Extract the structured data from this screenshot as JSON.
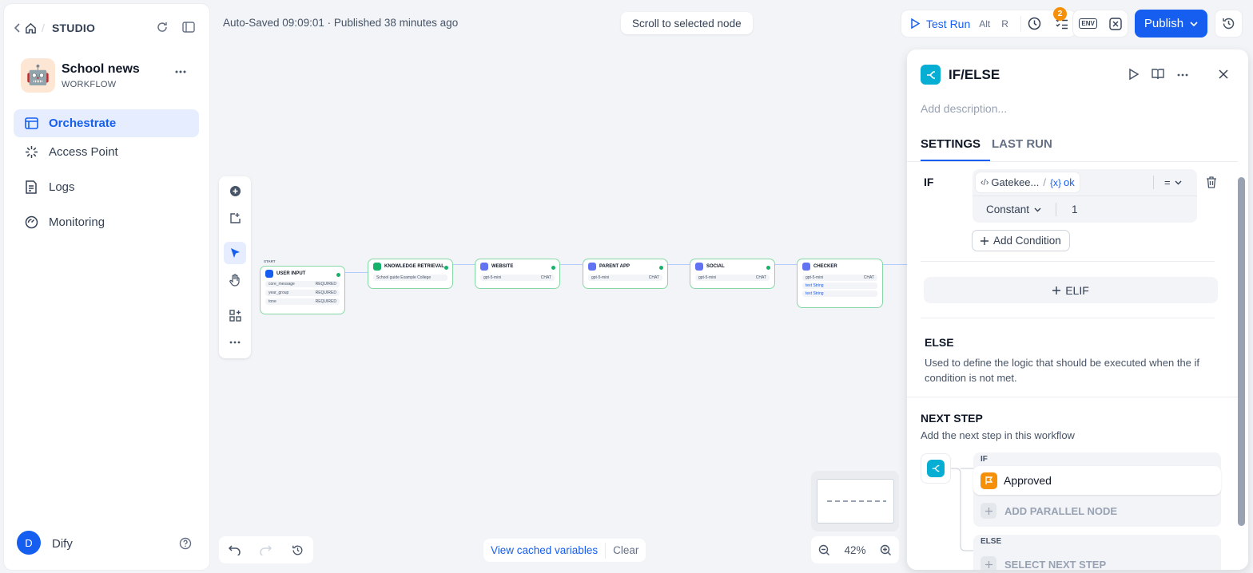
{
  "sidebar": {
    "breadcrumb": "STUDIO",
    "app": {
      "name": "School news",
      "type": "WORKFLOW"
    },
    "nav": [
      {
        "label": "Orchestrate",
        "active": true,
        "icon": "orchestrate-icon"
      },
      {
        "label": "Access Point",
        "active": false,
        "icon": "access-point-icon"
      },
      {
        "label": "Logs",
        "active": false,
        "icon": "logs-icon"
      },
      {
        "label": "Monitoring",
        "active": false,
        "icon": "monitoring-icon"
      }
    ],
    "user": {
      "initial": "D",
      "name": "Dify"
    }
  },
  "header": {
    "status": "Auto-Saved 09:09:01 · Published 38 minutes ago",
    "scroll_to_node": "Scroll to selected node",
    "test_run": {
      "label": "Test Run",
      "key1": "Alt",
      "key2": "R"
    },
    "checklist_badge": "2",
    "env": "ENV",
    "publish": "Publish"
  },
  "canvas": {
    "start_label": "START",
    "nodes": [
      {
        "title": "USER INPUT",
        "color": "#155eef",
        "rows": [
          "core_message",
          "year_group",
          "tone"
        ],
        "row_tag": "REQUIRED"
      },
      {
        "title": "KNOWLEDGE RETRIEVAL",
        "color": "#17b26a",
        "rows": [
          "School guide Example College"
        ]
      },
      {
        "title": "WEBSITE",
        "color": "#6172f3",
        "rows": [
          "gpt-5-mini"
        ],
        "row_tag": "CHAT"
      },
      {
        "title": "PARENT APP",
        "color": "#6172f3",
        "rows": [
          "gpt-5-mini"
        ],
        "row_tag": "CHAT"
      },
      {
        "title": "SOCIAL",
        "color": "#6172f3",
        "rows": [
          "gpt-5-mini"
        ],
        "row_tag": "CHAT"
      },
      {
        "title": "CHECKER",
        "color": "#6172f3",
        "rows": [
          "gpt-5-mini",
          "text String",
          "text String"
        ],
        "row_tag": "CHAT"
      }
    ],
    "cached_variables": "View cached variables",
    "clear": "Clear",
    "zoom": "42%"
  },
  "panel": {
    "title": "IF/ELSE",
    "description_placeholder": "Add description...",
    "tabs": [
      "SETTINGS",
      "LAST RUN"
    ],
    "if_label": "IF",
    "condition": {
      "node": "Gatekee...",
      "separator": "/",
      "var_prefix": "{x}",
      "variable": "ok",
      "operator": "=",
      "type": "Constant",
      "value": "1"
    },
    "add_condition": "Add Condition",
    "elif": "ELIF",
    "else_title": "ELSE",
    "else_desc": "Used to define the logic that should be executed when the if condition is not met.",
    "next_step_title": "NEXT STEP",
    "next_step_desc": "Add the next step in this workflow",
    "branches": {
      "if_label": "IF",
      "if_node": "Approved",
      "add_parallel": "ADD PARALLEL NODE",
      "else_label": "ELSE",
      "select_next": "SELECT NEXT STEP"
    }
  },
  "colors": {
    "accent": "#155eef",
    "success": "#17b26a",
    "ifelse": "#06aed4",
    "approved": "#f79009"
  }
}
